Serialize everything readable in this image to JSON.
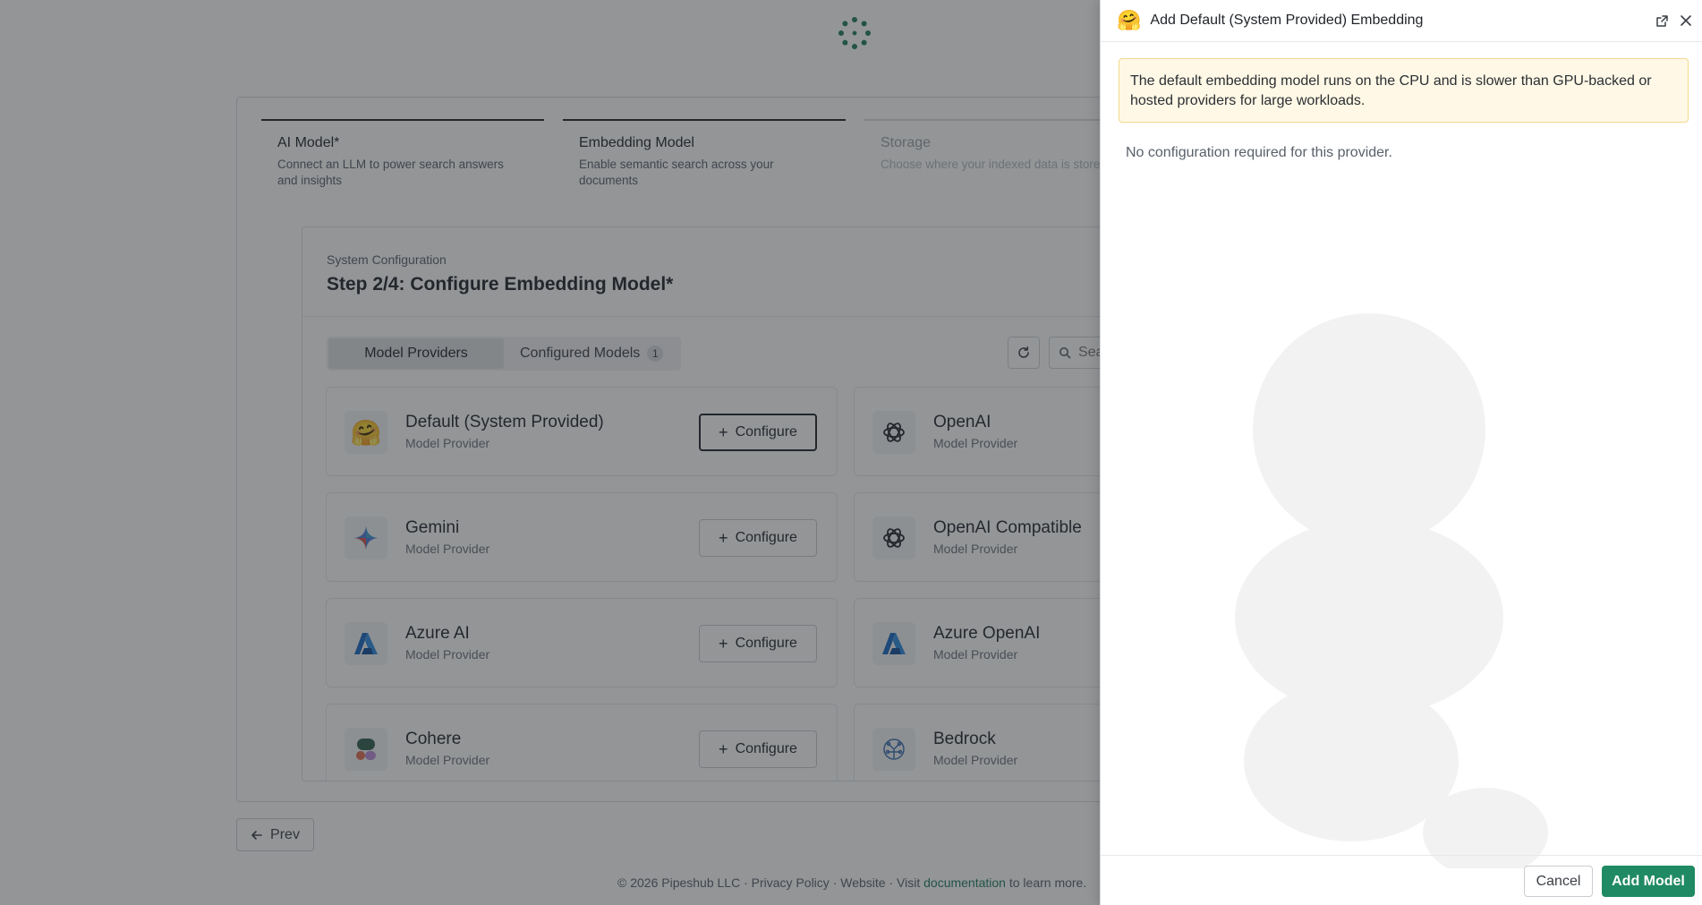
{
  "stepper": {
    "steps": [
      {
        "title": "AI Model*",
        "desc": "Connect an LLM to power search answers and insights"
      },
      {
        "title": "Embedding Model",
        "desc": "Enable semantic search across your documents"
      },
      {
        "title": "Storage",
        "desc": "Choose where your indexed data is stored"
      }
    ]
  },
  "card": {
    "subtitle": "System Configuration",
    "title": "Step 2/4: Configure Embedding Model*"
  },
  "tabs": {
    "providers": "Model Providers",
    "configured": "Configured Models",
    "configured_count": "1"
  },
  "search": {
    "placeholder": "Search"
  },
  "providers": [
    {
      "name": "Default (System Provided)",
      "type": "Model Provider",
      "action": "Configure",
      "icon": "hugging-face-icon"
    },
    {
      "name": "OpenAI",
      "type": "Model Provider",
      "icon": "openai-icon"
    },
    {
      "name": "Gemini",
      "type": "Model Provider",
      "action": "Configure",
      "icon": "gemini-icon"
    },
    {
      "name": "OpenAI Compatible",
      "type": "Model Provider",
      "icon": "openai-icon"
    },
    {
      "name": "Azure AI",
      "type": "Model Provider",
      "action": "Configure",
      "icon": "azure-icon"
    },
    {
      "name": "Azure OpenAI",
      "type": "Model Provider",
      "icon": "azure-icon"
    },
    {
      "name": "Cohere",
      "type": "Model Provider",
      "action": "Configure",
      "icon": "cohere-icon"
    },
    {
      "name": "Bedrock",
      "type": "Model Provider",
      "icon": "bedrock-icon"
    }
  ],
  "nav": {
    "prev": "Prev"
  },
  "footer": {
    "copyright": "© 2026 Pipeshub LLC",
    "privacy": "Privacy Policy",
    "website": "Website",
    "visit": "Visit",
    "documentation": "documentation",
    "learn": "to learn more."
  },
  "drawer": {
    "title": "Add Default (System Provided) Embedding",
    "alert": "The default embedding model runs on the CPU and is slower than GPU-backed or hosted providers for large workloads.",
    "no_config": "No configuration required for this provider.",
    "cancel": "Cancel",
    "add": "Add Model"
  },
  "colors": {
    "accent": "#1f8a63",
    "warning_bg": "#fff8e6"
  }
}
